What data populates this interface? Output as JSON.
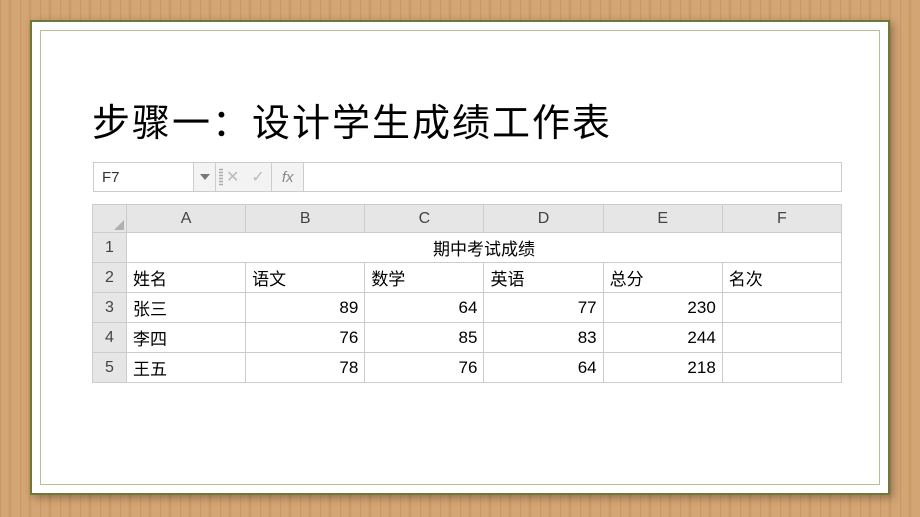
{
  "title": "步骤一：设计学生成绩工作表",
  "excel": {
    "name_box": "F7",
    "fx_label": "fx",
    "columns": [
      "A",
      "B",
      "C",
      "D",
      "E",
      "F"
    ],
    "merged_title": "期中考试成绩",
    "headers_row": {
      "row_num": "2",
      "cells": [
        "姓名",
        "语文",
        "数学",
        "英语",
        "总分",
        "名次"
      ]
    },
    "data_rows": [
      {
        "row_num": "3",
        "name": "张三",
        "chinese": "89",
        "math": "64",
        "english": "77",
        "total": "230",
        "rank": ""
      },
      {
        "row_num": "4",
        "name": "李四",
        "chinese": "76",
        "math": "85",
        "english": "83",
        "total": "244",
        "rank": ""
      },
      {
        "row_num": "5",
        "name": "王五",
        "chinese": "78",
        "math": "76",
        "english": "64",
        "total": "218",
        "rank": ""
      }
    ]
  },
  "chart_data": {
    "type": "table",
    "title": "期中考试成绩",
    "columns": [
      "姓名",
      "语文",
      "数学",
      "英语",
      "总分",
      "名次"
    ],
    "rows": [
      [
        "张三",
        89,
        64,
        77,
        230,
        null
      ],
      [
        "李四",
        76,
        85,
        83,
        244,
        null
      ],
      [
        "王五",
        78,
        76,
        64,
        218,
        null
      ]
    ]
  }
}
